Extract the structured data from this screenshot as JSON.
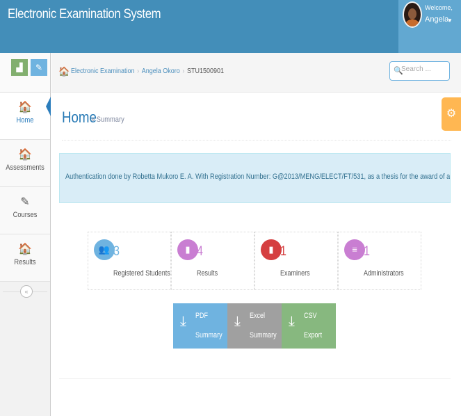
{
  "header": {
    "app_title": "Electronic Examination System",
    "welcome": "Welcome,",
    "username": "Angela",
    "caret": "▼",
    "colors": {
      "bar": "#438eb9",
      "user_box": "#62a8d1"
    }
  },
  "shortcuts": {
    "chart_icon": "▟",
    "edit_icon": "✎"
  },
  "sidebar": {
    "items": [
      {
        "label": "Home",
        "icon": "🏠",
        "active": true
      },
      {
        "label": "Assessments",
        "icon": "🏠",
        "active": false
      },
      {
        "label": "Courses",
        "icon": "✎",
        "active": false
      },
      {
        "label": "Results",
        "icon": "🏠",
        "active": false
      }
    ],
    "collapse_glyph": "«"
  },
  "breadcrumbs": {
    "home_icon": "🏠",
    "items": [
      "Electronic Examination",
      "Angela Okoro",
      "STU1500901"
    ],
    "separator": "›"
  },
  "search": {
    "placeholder": "Search ...",
    "icon": "🔍"
  },
  "page": {
    "title": "Home",
    "subtitle": "» Summary",
    "settings_icon": "⚙"
  },
  "alert": {
    "text": "Authentication done by Robetta Mukoro E. A. With Registration Number: G@2013/MENG/ELECT/FT/531, as a thesis for the award of a Masters Deg"
  },
  "stats": [
    {
      "value": "3",
      "label": "Registered Students",
      "icon": "👥",
      "color": "#6fb3e0"
    },
    {
      "value": "4",
      "label": "Results",
      "icon": "▮",
      "color": "#c97ed2"
    },
    {
      "value": "1",
      "label": "Examiners",
      "icon": "▮",
      "color": "#d53f40"
    },
    {
      "value": "1",
      "label": "Administrators",
      "icon": "≡",
      "color": "#c97ed2"
    }
  ],
  "exports": [
    {
      "line1": "PDF",
      "line2": "Summary",
      "icon": "⤓",
      "color": "#6fb3e0"
    },
    {
      "line1": "Excel",
      "line2": "Summary",
      "icon": "⤓",
      "color": "#a0a0a0"
    },
    {
      "line1": "CSV",
      "line2": "Export",
      "icon": "⤓",
      "color": "#87b87f"
    }
  ]
}
